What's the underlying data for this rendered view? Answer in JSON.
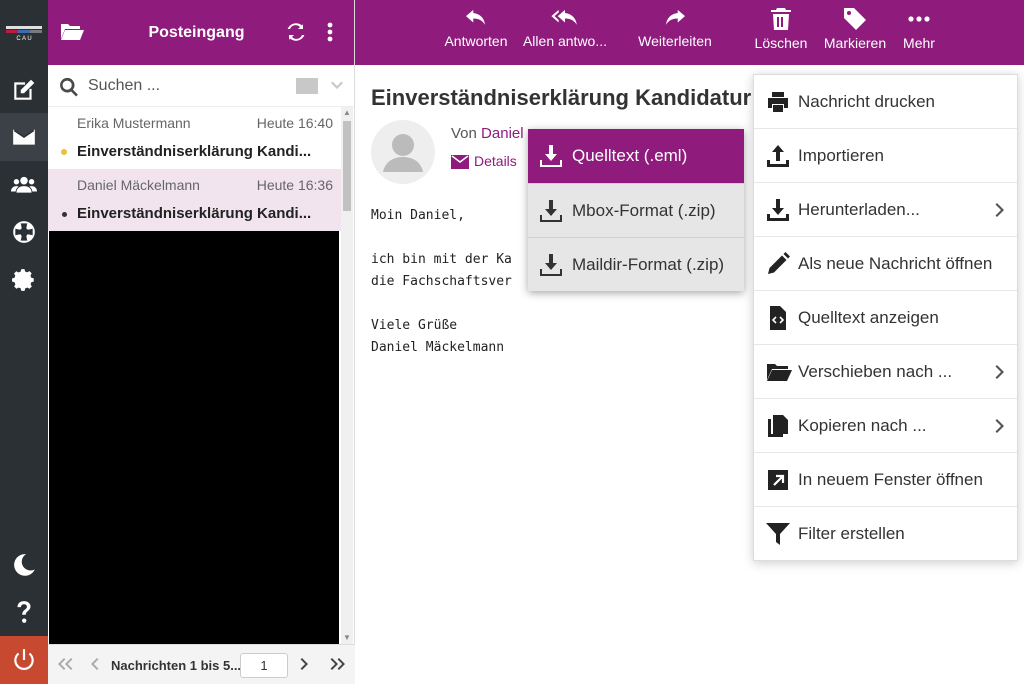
{
  "rail": {
    "logo_text": "C A U",
    "logo_colors": [
      "#e0e0e0",
      "#b51e3d",
      "#3c6cb4",
      "#7a7a7a"
    ]
  },
  "list": {
    "title": "Posteingang",
    "search_placeholder": "Suchen ...",
    "messages": [
      {
        "from": "Erika Mustermann",
        "time": "Heute 16:40",
        "subject": "Einverständniserklärung Kandi..."
      },
      {
        "from": "Daniel Mäckelmann",
        "time": "Heute 16:36",
        "subject": "Einverständniserklärung Kandi..."
      }
    ],
    "pager_label": "Nachrichten 1 bis 5...",
    "pager_page": "1"
  },
  "toolbar": {
    "reply": "Antworten",
    "reply_all": "Allen antwo...",
    "forward": "Weiterleiten",
    "delete": "Löschen",
    "mark": "Markieren",
    "more": "Mehr"
  },
  "message": {
    "subject": "Einverständniserklärung Kandidatur",
    "from_label": "Von",
    "from_name": "Daniel",
    "details": "Details",
    "body": "Moin Daniel,\n\nich bin mit der Ka\ndie Fachschaftsver\n\nViele Grüße\nDaniel Mäckelmann"
  },
  "download_menu": {
    "items": [
      "Quelltext (.eml)",
      "Mbox-Format (.zip)",
      "Maildir-Format (.zip)"
    ]
  },
  "more_menu": {
    "items": [
      {
        "label": "Nachricht drucken",
        "icon": "print-icon"
      },
      {
        "label": "Importieren",
        "icon": "upload-icon"
      },
      {
        "label": "Herunterladen...",
        "icon": "download-icon"
      },
      {
        "label": "Als neue Nachricht öffnen",
        "icon": "pencil-icon"
      },
      {
        "label": "Quelltext anzeigen",
        "icon": "file-code-icon"
      },
      {
        "label": "Verschieben nach ...",
        "icon": "folder-open-icon"
      },
      {
        "label": "Kopieren nach ...",
        "icon": "copy-icon"
      },
      {
        "label": "In neuem Fenster öffnen",
        "icon": "external-link-icon"
      },
      {
        "label": "Filter erstellen",
        "icon": "filter-icon"
      }
    ]
  },
  "colors": {
    "accent": "#8f1b7d",
    "rail": "#2b3034",
    "power": "#c7492f"
  }
}
